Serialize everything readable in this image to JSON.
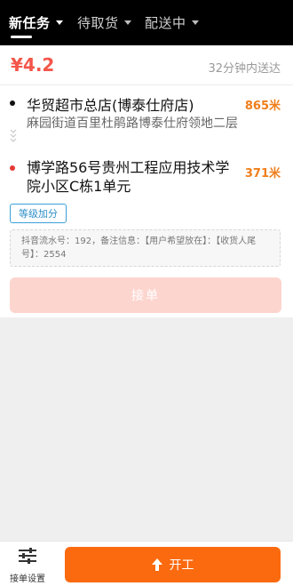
{
  "tabs": [
    {
      "label": "新任务",
      "active": true
    },
    {
      "label": "待取货",
      "active": false
    },
    {
      "label": "配送中",
      "active": false
    }
  ],
  "order": {
    "price": "¥4.2",
    "deliver_time": "32分钟内送达",
    "pickup_name": "华贸超市总店(博泰仕府店)",
    "pickup_distance": "865米",
    "pickup_address": "麻园街道百里杜鹃路博泰仕府领地二层",
    "dropoff_address": "博学路56号贵州工程应用技术学院小区C栋1单元",
    "dropoff_distance": "371米",
    "badge": "等级加分",
    "note": "抖音流水号：192，备注信息：【用户希望放在】：【收货人尾号】：2554",
    "grab_label": "接单"
  },
  "bottom": {
    "settings_label": "接单设置",
    "start_label": "开工"
  },
  "colors": {
    "accent": "#fb6a0f",
    "price": "#f4564a",
    "distance": "#f07e1b",
    "badge": "#2f8fc8"
  }
}
